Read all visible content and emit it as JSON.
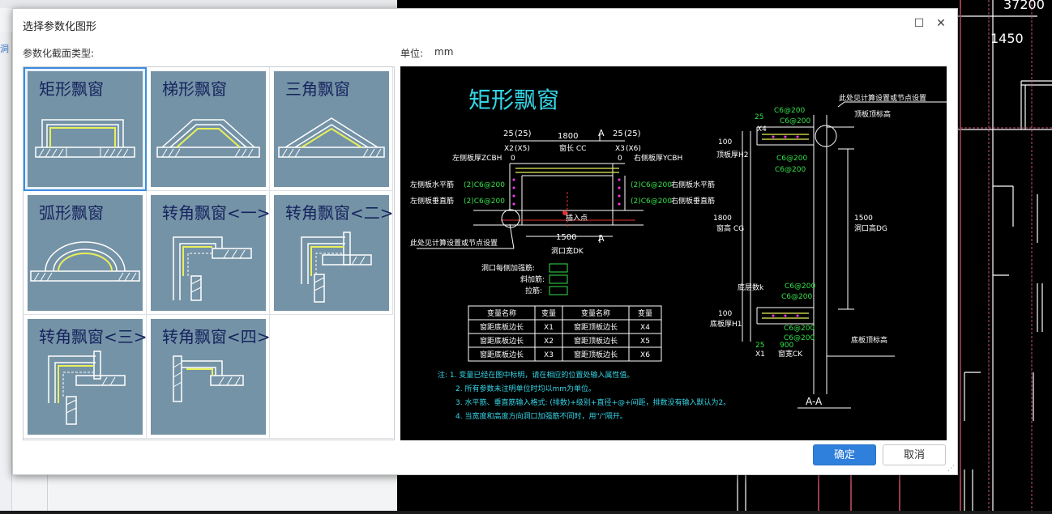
{
  "background": {
    "cad_dimension_top": "37200",
    "cad_dimension": "1450",
    "left_hint": "洞"
  },
  "dialog": {
    "title": "选择参数化图形",
    "section_type_label": "参数化截面类型:",
    "unit_label": "单位:",
    "unit_value": "mm",
    "ok_label": "确定",
    "cancel_label": "取消",
    "maximize_icon": "maximize-icon",
    "close_icon": "close-icon"
  },
  "shapes": [
    {
      "label": "矩形飘窗",
      "selected": true
    },
    {
      "label": "梯形飘窗",
      "selected": false
    },
    {
      "label": "三角飘窗",
      "selected": false
    },
    {
      "label": "弧形飘窗",
      "selected": false
    },
    {
      "label": "转角飘窗<一>",
      "selected": false
    },
    {
      "label": "转角飘窗<二>",
      "selected": false
    },
    {
      "label": "转角飘窗<三>",
      "selected": false
    },
    {
      "label": "转角飘窗<四>",
      "selected": false
    }
  ],
  "preview": {
    "title": "矩形飘窗",
    "plan": {
      "dim_top": "1800",
      "window_length": "窗长 CC",
      "left_thickness": "左侧板厚ZCBH",
      "right_thickness": "右侧板厚YCBH",
      "left_h_rebar": "左侧板水平筋",
      "right_h_rebar": "右侧板水平筋",
      "left_v_rebar": "左侧板垂直筋",
      "right_v_rebar": "右侧板垂直筋",
      "rebar_code": "(2)C6@200",
      "insert_point": "插入点",
      "dim_bottom": "1500",
      "opening_width": "洞口宽DK",
      "see_note": "此处见计算设置或节点设置",
      "x2": "X2",
      "x5": "(X5)",
      "x3": "X3",
      "x6": "(X6)",
      "d25": "25",
      "d25b": "(25)",
      "zero": "0",
      "section_mark": "A"
    },
    "reinforcement": {
      "opening_rebar": "洞口每侧加强筋:",
      "diag_rebar": "斜加筋:",
      "tie_rebar": "拉筋:"
    },
    "table": {
      "headers": [
        "变量名称",
        "变量",
        "变量名称",
        "变量"
      ],
      "rows": [
        [
          "窗距底板边长",
          "X1",
          "窗距顶板边长",
          "X4"
        ],
        [
          "窗距底板边长",
          "X2",
          "窗距顶板边长",
          "X5"
        ],
        [
          "窗距底板边长",
          "X3",
          "窗距顶板边长",
          "X6"
        ]
      ]
    },
    "notes": [
      "注: 1. 变量已经在图中标明，请在相应的位置处输入属性值。",
      "2. 所有参数未注明单位时均以mm为单位。",
      "3. 水平筋、垂直筋输入格式: (排数)+级别+直径+@+间距，排数没有输入默认为2。",
      "4. 当宽度和高度方向洞口加强筋不同时，用\"/\"隔开。"
    ],
    "section": {
      "see_note": "此处见计算设置或节点设置",
      "top_elev": "顶板顶标高",
      "bottom_elev": "底板顶标高",
      "top_thickness": "顶板厚H2",
      "bottom_thickness": "底板厚H1",
      "window_height": "窗高 CG",
      "opening_height": "洞口高DG",
      "window_width": "窗宽CK",
      "section_label": "A-A",
      "x4": "X4",
      "x1": "X1",
      "d25": "25",
      "d100": "100",
      "d1800": "1800",
      "d1500": "1500",
      "d900": "900",
      "rebar": "C6@200",
      "bottom_rebar_code": "底层数k"
    }
  }
}
